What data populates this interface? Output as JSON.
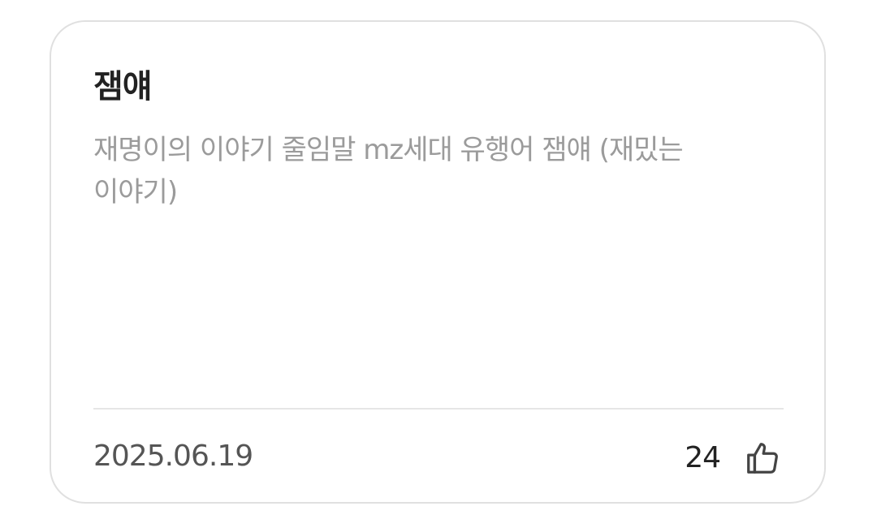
{
  "card": {
    "title": "잼얘",
    "description": "재명이의 이야기 줄임말 mz세대 유행어 잼얘 (재밌는이야기)",
    "date": "2025.06.19",
    "like_count": "24",
    "like_icon": "thumbs-up-icon"
  },
  "colors": {
    "title": "#222222",
    "description": "#9b9b9b",
    "date": "#555555",
    "border": "#e0e0e0",
    "divider": "#e6e6e6"
  }
}
